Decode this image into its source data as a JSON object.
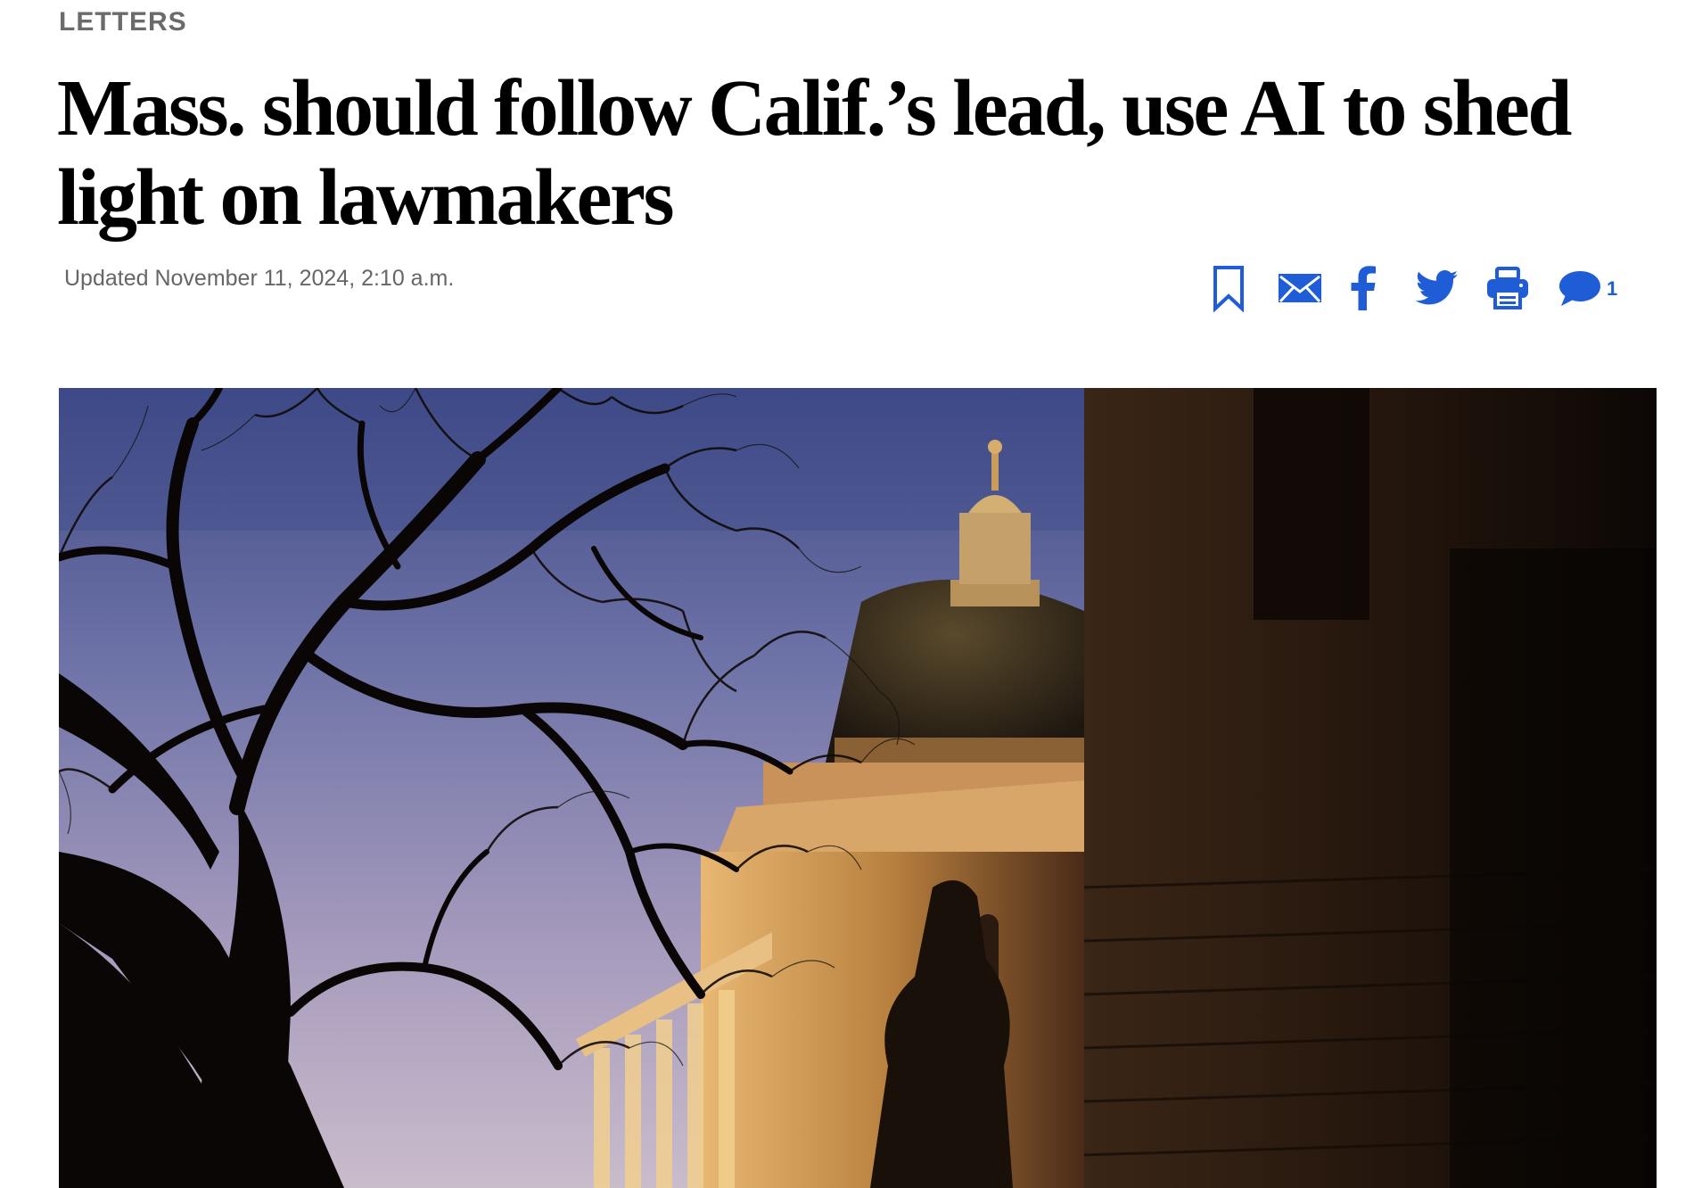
{
  "article": {
    "section": "LETTERS",
    "headline": "Mass. should follow Calif.’s lead, use AI to shed light on lawmakers",
    "dateline": "Updated November 11, 2024, 2:10 a.m."
  },
  "share_bar": {
    "comment_count": "1",
    "icons": [
      "bookmark-icon",
      "email-icon",
      "facebook-icon",
      "twitter-icon",
      "print-icon",
      "comment-icon"
    ],
    "accent_color": "#1f5dd6"
  },
  "hero_image": {
    "subject": "Massachusetts State House dome at dusk behind silhouetted tree"
  }
}
